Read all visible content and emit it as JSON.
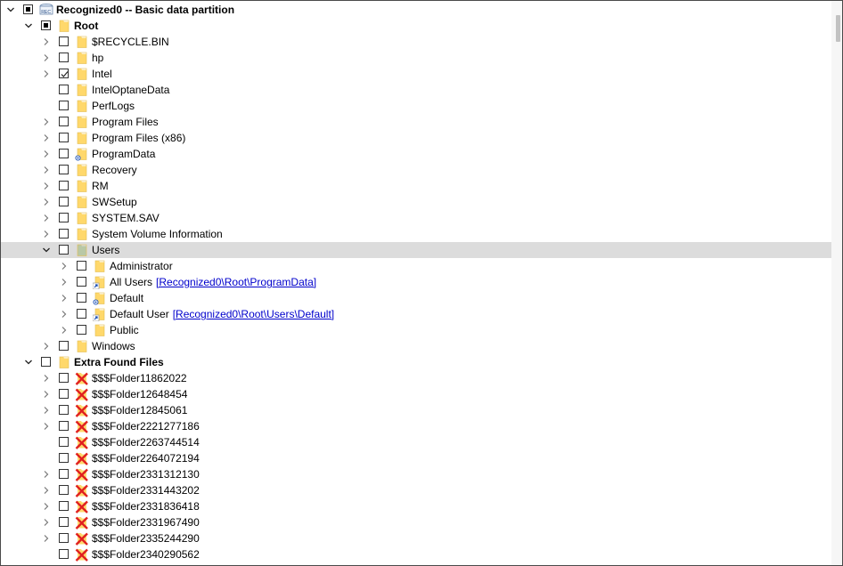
{
  "tree": {
    "drive": {
      "label": "Recognized0 -- Basic data partition",
      "icon": "drive-icon",
      "check": "partial"
    },
    "root": {
      "label": "Root",
      "check": "partial"
    },
    "root_children": [
      {
        "label": "$RECYCLE.BIN",
        "expandable": true,
        "check": "none",
        "icon": "folder-icon"
      },
      {
        "label": "hp",
        "expandable": true,
        "check": "none",
        "icon": "folder-icon"
      },
      {
        "label": "Intel",
        "expandable": true,
        "check": "checked",
        "icon": "folder-icon"
      },
      {
        "label": "IntelOptaneData",
        "expandable": false,
        "check": "none",
        "icon": "folder-icon"
      },
      {
        "label": "PerfLogs",
        "expandable": false,
        "check": "none",
        "icon": "folder-icon"
      },
      {
        "label": "Program Files",
        "expandable": true,
        "check": "none",
        "icon": "folder-icon"
      },
      {
        "label": "Program Files (x86)",
        "expandable": true,
        "check": "none",
        "icon": "folder-icon"
      },
      {
        "label": "ProgramData",
        "expandable": true,
        "check": "none",
        "icon": "folder-special-icon"
      },
      {
        "label": "Recovery",
        "expandable": true,
        "check": "none",
        "icon": "folder-icon"
      },
      {
        "label": "RM",
        "expandable": true,
        "check": "none",
        "icon": "folder-icon"
      },
      {
        "label": "SWSetup",
        "expandable": true,
        "check": "none",
        "icon": "folder-icon"
      },
      {
        "label": "SYSTEM.SAV",
        "expandable": true,
        "check": "none",
        "icon": "folder-icon"
      },
      {
        "label": "System Volume Information",
        "expandable": true,
        "check": "none",
        "icon": "folder-icon"
      }
    ],
    "users": {
      "label": "Users",
      "check": "none",
      "children": [
        {
          "label": "Administrator",
          "expandable": true,
          "check": "none",
          "icon": "folder-icon",
          "link": ""
        },
        {
          "label": "All Users",
          "expandable": true,
          "check": "none",
          "icon": "folder-link-icon",
          "link": "[Recognized0\\Root\\ProgramData]"
        },
        {
          "label": "Default",
          "expandable": true,
          "check": "none",
          "icon": "folder-special-icon",
          "link": ""
        },
        {
          "label": "Default User",
          "expandable": true,
          "check": "none",
          "icon": "folder-link-icon",
          "link": "[Recognized0\\Root\\Users\\Default]"
        },
        {
          "label": "Public",
          "expandable": true,
          "check": "none",
          "icon": "folder-icon",
          "link": ""
        }
      ]
    },
    "windows": {
      "label": "Windows",
      "check": "none"
    },
    "extra": {
      "label": "Extra Found Files",
      "check": "none",
      "children": [
        {
          "label": "$$$Folder11862022",
          "expandable": true
        },
        {
          "label": "$$$Folder12648454",
          "expandable": true
        },
        {
          "label": "$$$Folder12845061",
          "expandable": true
        },
        {
          "label": "$$$Folder2221277186",
          "expandable": true
        },
        {
          "label": "$$$Folder2263744514",
          "expandable": false
        },
        {
          "label": "$$$Folder2264072194",
          "expandable": false
        },
        {
          "label": "$$$Folder2331312130",
          "expandable": true
        },
        {
          "label": "$$$Folder2331443202",
          "expandable": true
        },
        {
          "label": "$$$Folder2331836418",
          "expandable": true
        },
        {
          "label": "$$$Folder2331967490",
          "expandable": true
        },
        {
          "label": "$$$Folder2335244290",
          "expandable": true
        },
        {
          "label": "$$$Folder2340290562",
          "expandable": false
        }
      ]
    },
    "colors": {
      "folder": "#ffd86b",
      "folder_selected": "#b9c8a6",
      "link": "#0000cc",
      "deleted": "#e02020",
      "selected_row": "#dcdcdc"
    }
  }
}
